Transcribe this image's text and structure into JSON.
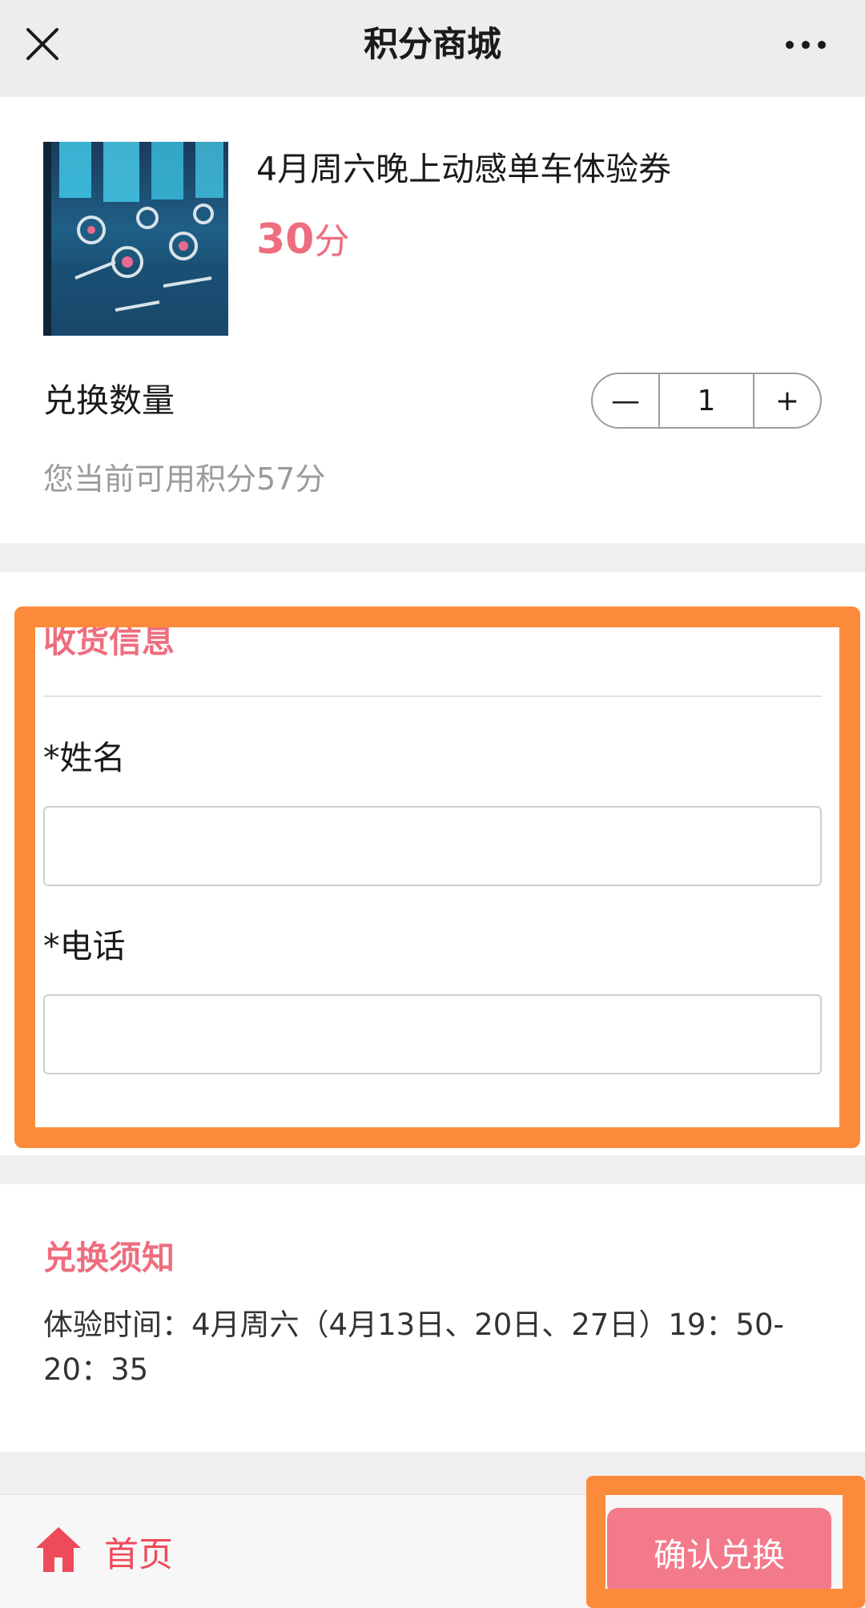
{
  "nav": {
    "title": "积分商城",
    "close_icon": "close-icon",
    "more_icon": "more-horizontal-icon"
  },
  "product": {
    "name": "4月周六晚上动感单车体验券",
    "price_value": "30",
    "price_unit": "分",
    "image": "spin-bike-studio-photo"
  },
  "quantity": {
    "label": "兑换数量",
    "minus": "—",
    "value": "1",
    "plus": "+"
  },
  "points_note": "您当前可用积分57分",
  "shipping": {
    "title": "收货信息",
    "name_label": "*姓名",
    "name_value": "",
    "phone_label": "*电话",
    "phone_value": ""
  },
  "notice": {
    "title": "兑换须知",
    "body": "体验时间：4月周六（4月13日、20日、27日）19：50-20：35"
  },
  "bottom": {
    "home_icon": "home-icon",
    "home_label": "首页",
    "confirm_label": "确认兑换"
  },
  "colors": {
    "accent": "#ee6d7e",
    "home_red": "#ee4a5a",
    "confirm_bg": "#f37a8b",
    "highlight": "#fb8b3a"
  }
}
